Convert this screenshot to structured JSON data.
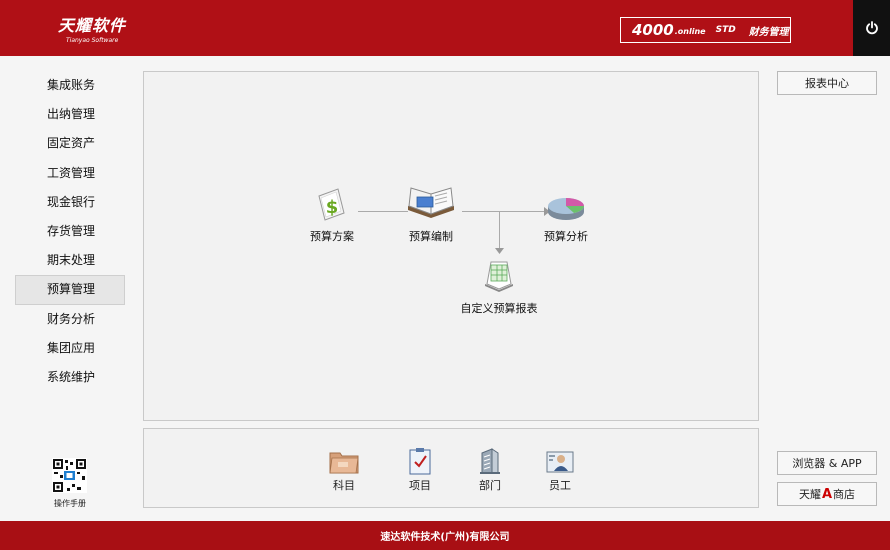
{
  "header": {
    "logo_cn": "天耀软件",
    "logo_en": "Tianyao Software",
    "version_number": "4000",
    "version_online": ".online",
    "version_edition": "STD",
    "module_name": "财务管理"
  },
  "sidebar": {
    "items": [
      {
        "label": "集成账务"
      },
      {
        "label": "出纳管理"
      },
      {
        "label": "固定资产"
      },
      {
        "label": "工资管理"
      },
      {
        "label": "现金银行"
      },
      {
        "label": "存货管理"
      },
      {
        "label": "期末处理"
      },
      {
        "label": "预算管理",
        "active": true
      },
      {
        "label": "财务分析"
      },
      {
        "label": "集团应用"
      },
      {
        "label": "系统维护"
      }
    ],
    "manual_label": "操作手册"
  },
  "flow": {
    "budget_plan": "预算方案",
    "budget_compile": "预算编制",
    "budget_analysis": "预算分析",
    "custom_report": "自定义预算报表"
  },
  "bottom": {
    "subject": "科目",
    "project": "项目",
    "department": "部门",
    "employee": "员工"
  },
  "right": {
    "report_center": "报表中心",
    "browser_app": "浏览器 & APP",
    "store_prefix": "天耀",
    "store_mark": "A",
    "store_suffix": "商店"
  },
  "footer": {
    "company": "速达软件技术(广州)有限公司"
  },
  "colors": {
    "brand_red": "#b01016",
    "footer_red": "#a80f14",
    "panel_bg": "#f2f2f2"
  }
}
